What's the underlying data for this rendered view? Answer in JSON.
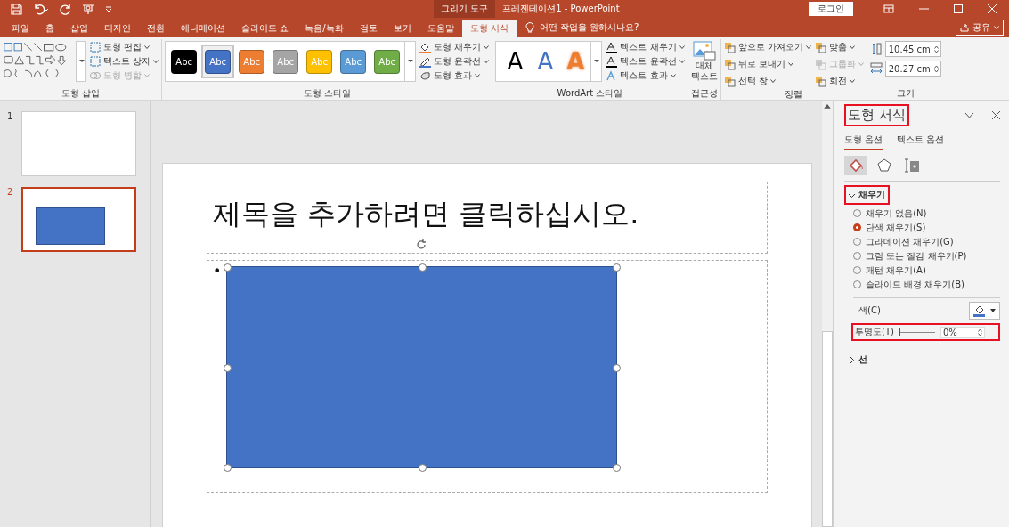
{
  "title_bar": {
    "context_tab": "그리기 도구",
    "title": "프레젠테이션1  -  PowerPoint",
    "login": "로그인"
  },
  "tabs": [
    {
      "label": "파일",
      "selected": false
    },
    {
      "label": "홈",
      "selected": false
    },
    {
      "label": "삽입",
      "selected": false
    },
    {
      "label": "디자인",
      "selected": false
    },
    {
      "label": "전환",
      "selected": false
    },
    {
      "label": "애니메이션",
      "selected": false
    },
    {
      "label": "슬라이드 쇼",
      "selected": false
    },
    {
      "label": "녹음/녹화",
      "selected": false
    },
    {
      "label": "검토",
      "selected": false
    },
    {
      "label": "보기",
      "selected": false
    },
    {
      "label": "도움말",
      "selected": false
    },
    {
      "label": "도형 서식",
      "selected": true
    }
  ],
  "tell_me": "어떤 작업을 원하시나요?",
  "share": "공유",
  "ribbon": {
    "insert_shapes": {
      "label": "도형 삽입",
      "buttons": [
        {
          "label": "도형 편집",
          "disabled": false
        },
        {
          "label": "텍스트 상자",
          "disabled": false
        },
        {
          "label": "도형 병합",
          "disabled": true
        }
      ]
    },
    "shape_styles": {
      "label": "도형 스타일",
      "swatches": [
        {
          "text": "Abc",
          "color": "#000000",
          "selected": false
        },
        {
          "text": "Abc",
          "color": "#4472c4",
          "selected": true
        },
        {
          "text": "Abc",
          "color": "#ed7d31",
          "selected": false
        },
        {
          "text": "Abc",
          "color": "#a5a5a5",
          "selected": false
        },
        {
          "text": "Abc",
          "color": "#ffc000",
          "selected": false
        },
        {
          "text": "Abc",
          "color": "#5b9bd5",
          "selected": false
        },
        {
          "text": "Abc",
          "color": "#70ad47",
          "selected": false
        }
      ],
      "buttons": [
        {
          "label": "도형 채우기",
          "kind": "fill"
        },
        {
          "label": "도형 윤곽선",
          "kind": "outline"
        },
        {
          "label": "도형 효과",
          "kind": "effect"
        }
      ]
    },
    "wordart": {
      "label": "WordArt 스타일",
      "samples": [
        {
          "text": "A",
          "color": "#000000",
          "kind": "solid"
        },
        {
          "text": "A",
          "color": "#4472c4",
          "kind": "solid"
        },
        {
          "text": "A",
          "color": "#ed7d31",
          "kind": "outline"
        }
      ],
      "buttons": [
        {
          "label": "텍스트 채우기",
          "kind": "fill"
        },
        {
          "label": "텍스트 윤곽선",
          "kind": "outline"
        },
        {
          "label": "텍스트 효과",
          "kind": "effect"
        }
      ]
    },
    "accessibility": {
      "label": "접근성",
      "button": "대체 텍스트"
    },
    "arrange": {
      "label": "정렬",
      "buttons": [
        {
          "label": "앞으로 가져오기",
          "disabled": false
        },
        {
          "label": "뒤로 보내기",
          "disabled": false
        },
        {
          "label": "선택 창",
          "disabled": false
        },
        {
          "label": "맞춤",
          "disabled": false
        },
        {
          "label": "그룹화",
          "disabled": true
        },
        {
          "label": "회전",
          "disabled": false
        }
      ]
    },
    "size": {
      "label": "크기",
      "height": "10.45 cm",
      "width": "20.27 cm"
    }
  },
  "slides": [
    {
      "number": "1",
      "selected": false,
      "has_shape": false
    },
    {
      "number": "2",
      "selected": true,
      "has_shape": true
    }
  ],
  "slide": {
    "title_placeholder": "제목을 추가하려면 클릭하십시오.",
    "bullet": "•",
    "shape_selected": true
  },
  "format_pane": {
    "title": "도형 서식",
    "highlighted": true,
    "tabs": [
      {
        "label": "도형 옵션",
        "selected": true
      },
      {
        "label": "텍스트 옵션",
        "selected": false
      }
    ],
    "fill": {
      "label": "채우기",
      "expanded": true,
      "highlighted": true,
      "options": [
        {
          "label": "채우기 없음(N)",
          "selected": false
        },
        {
          "label": "단색 채우기(S)",
          "selected": true
        },
        {
          "label": "그라데이션 채우기(G)",
          "selected": false
        },
        {
          "label": "그림 또는 질감 채우기(P)",
          "selected": false
        },
        {
          "label": "패턴 채우기(A)",
          "selected": false
        },
        {
          "label": "슬라이드 배경 채우기(B)",
          "selected": false
        }
      ],
      "color_label": "색(C)",
      "transparency": {
        "label": "투명도(T)",
        "level": 0,
        "value": "0%",
        "highlighted": true
      }
    },
    "line": {
      "label": "선",
      "expanded": false
    }
  }
}
